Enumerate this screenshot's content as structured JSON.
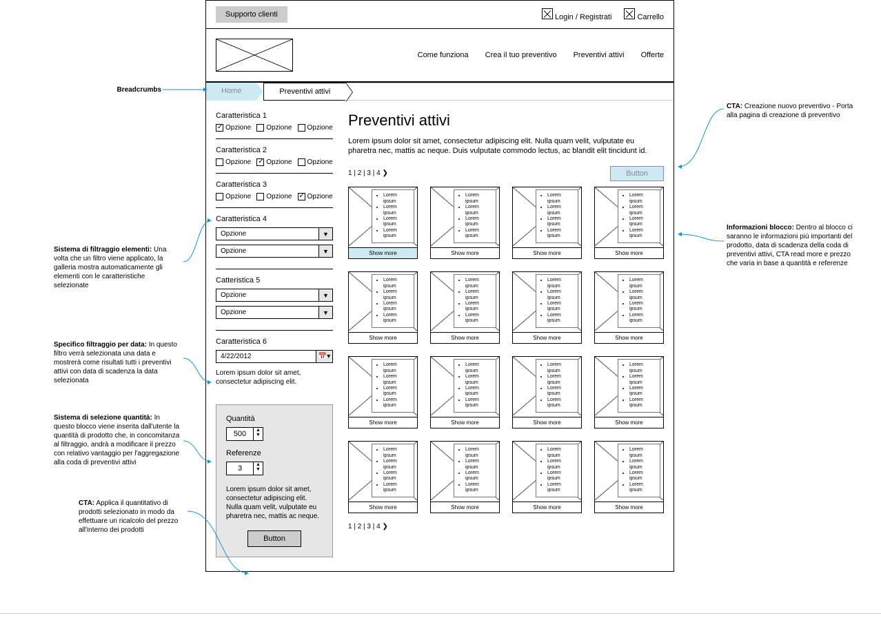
{
  "topbar": {
    "support": "Supporto clienti",
    "login": "Login /  Registrati",
    "cart": "Carrello"
  },
  "nav": {
    "items": [
      "Come funziona",
      "Crea il tuo preventivo",
      "Preventivi attivi",
      "Offerte"
    ]
  },
  "breadcrumb": {
    "home": "Home",
    "current": "Preventivi attivi"
  },
  "filters": {
    "groups": [
      {
        "title": "Caratteristica 1",
        "options": [
          "Opzione",
          "Opzione",
          "Opzione"
        ],
        "checked": 0
      },
      {
        "title": "Caratteristica 2",
        "options": [
          "Opzione",
          "Opzione",
          "Opzione"
        ],
        "checked": 1
      },
      {
        "title": "Caratteristica 3",
        "options": [
          "Opzione",
          "Opzione",
          "Opzione"
        ],
        "checked": 2
      }
    ],
    "selects": [
      {
        "title": "Caratteristica 4",
        "options": [
          "Opzione",
          "Opzione"
        ]
      },
      {
        "title": "Catteristica 5",
        "options": [
          "Opzione",
          "Opzione"
        ]
      }
    ],
    "date": {
      "title": "Caratteristica 6",
      "value": "4/22/2012",
      "helper": "Lorem ipsum dolor sit amet, consectetur adipiscing elit."
    }
  },
  "qty": {
    "q_label": "Quantità",
    "q_val": "500",
    "r_label": "Referenze",
    "r_val": "3",
    "helper": "Lorem ipsum dolor sit amet, consectetur adipiscing elit. Nulla quam velit, vulputate eu pharetra nec, mattis ac neque.",
    "button": "Button"
  },
  "main": {
    "title": "Preventivi attivi",
    "desc": "Lorem ipsum dolor sit amet, consectetur adipiscing elit. Nulla quam velit, vulputate eu pharetra nec, mattis ac neque. Duis vulputate commodo lectus, ac blandit elit tincidunt id.",
    "pager": "1 | 2 | 3 | 4 ❯",
    "cta": "Button",
    "card_info": [
      "Lorem ipsum",
      "Lorem ipsum",
      "Lorem ipsum",
      "Lorem ipsum"
    ],
    "show_more": "Show more"
  },
  "annotations": {
    "breadcrumbs": {
      "title": "Breadcrumbs"
    },
    "filter": {
      "title": "Sistema di filtraggio elementi:",
      "text": "Una volta che un filtro viene applicato, la galleria mostra automaticamente gli elementi con le caratteristiche selezionate"
    },
    "date": {
      "title": "Specifico filtraggio per data:",
      "text": "In questo filtro verrà selezionata una data e mostrerà come risultati tutti i preventivi attivi con data di scadenza la data selezionata"
    },
    "qty": {
      "title": "Sistema di selezione quantità:",
      "text": "In questo blocco viene inserita dall'utente la quantità di prodotto che, in concomitanza al filtraggio, andrà a modificare il prezzo con relativo vantaggio per l'aggregazione alla coda di preventivi attivi"
    },
    "cta_apply": {
      "title": "CTA:",
      "text": "Applica il quantitativo di prodotti selezionato in modo da effettuare un ricalcolo del prezzo all'interno dei prodotti"
    },
    "cta_new": {
      "title": "CTA:",
      "text": "Creazione nuovo preventivo -  Porta alla pagina di creazione di preventivo"
    },
    "info": {
      "title": "Informazioni blocco:",
      "text": "Dentro al blocco ci saranno le informazioni più importanti del prodotto, data di scadenza della coda di preventivi attivi, CTA read more e prezzo che varia in base a quantità e referenze"
    }
  }
}
